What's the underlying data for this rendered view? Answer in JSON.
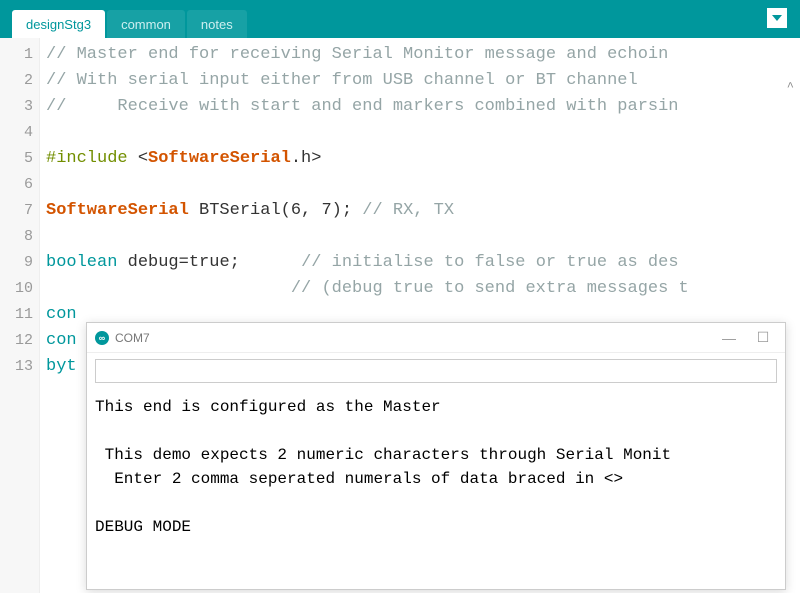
{
  "tabs": {
    "active": "designStg3",
    "items": [
      "designStg3",
      "common",
      "notes"
    ]
  },
  "code": {
    "lines": [
      {
        "n": 1,
        "segs": [
          {
            "cls": "c-comment",
            "t": "// Master end for receiving Serial Monitor message and echoin"
          }
        ]
      },
      {
        "n": 2,
        "segs": [
          {
            "cls": "c-comment",
            "t": "// With serial input either from USB channel or BT channel"
          }
        ]
      },
      {
        "n": 3,
        "segs": [
          {
            "cls": "c-comment",
            "t": "//     Receive with start and end markers combined with parsin"
          }
        ]
      },
      {
        "n": 4,
        "segs": []
      },
      {
        "n": 5,
        "segs": [
          {
            "cls": "c-preproc",
            "t": "#include "
          },
          {
            "cls": "c-plain",
            "t": "<"
          },
          {
            "cls": "c-type",
            "t": "SoftwareSerial"
          },
          {
            "cls": "c-plain",
            "t": ".h>"
          }
        ]
      },
      {
        "n": 6,
        "segs": []
      },
      {
        "n": 7,
        "segs": [
          {
            "cls": "c-type",
            "t": "SoftwareSerial"
          },
          {
            "cls": "c-plain",
            "t": " BTSerial(6, 7); "
          },
          {
            "cls": "c-comment",
            "t": "// RX, TX"
          }
        ]
      },
      {
        "n": 8,
        "segs": []
      },
      {
        "n": 9,
        "segs": [
          {
            "cls": "c-kw",
            "t": "boolean"
          },
          {
            "cls": "c-plain",
            "t": " debug=true;      "
          },
          {
            "cls": "c-comment",
            "t": "// initialise to false or true as des"
          }
        ]
      },
      {
        "n": 10,
        "segs": [
          {
            "cls": "c-plain",
            "t": "                        "
          },
          {
            "cls": "c-comment",
            "t": "// (debug true to send extra messages t"
          }
        ]
      },
      {
        "n": 11,
        "segs": [
          {
            "cls": "c-kw",
            "t": "con"
          }
        ]
      },
      {
        "n": 12,
        "segs": [
          {
            "cls": "c-kw",
            "t": "con"
          }
        ]
      },
      {
        "n": 13,
        "segs": [
          {
            "cls": "c-kw",
            "t": "byt"
          }
        ]
      }
    ]
  },
  "serial": {
    "title": "COM7",
    "input_value": "",
    "lines": [
      "This end is configured as the Master",
      "",
      " This demo expects 2 numeric characters through Serial Monit",
      "  Enter 2 comma seperated numerals of data braced in <>",
      "",
      "DEBUG MODE"
    ],
    "win": {
      "min": "—",
      "max": "☐"
    }
  }
}
